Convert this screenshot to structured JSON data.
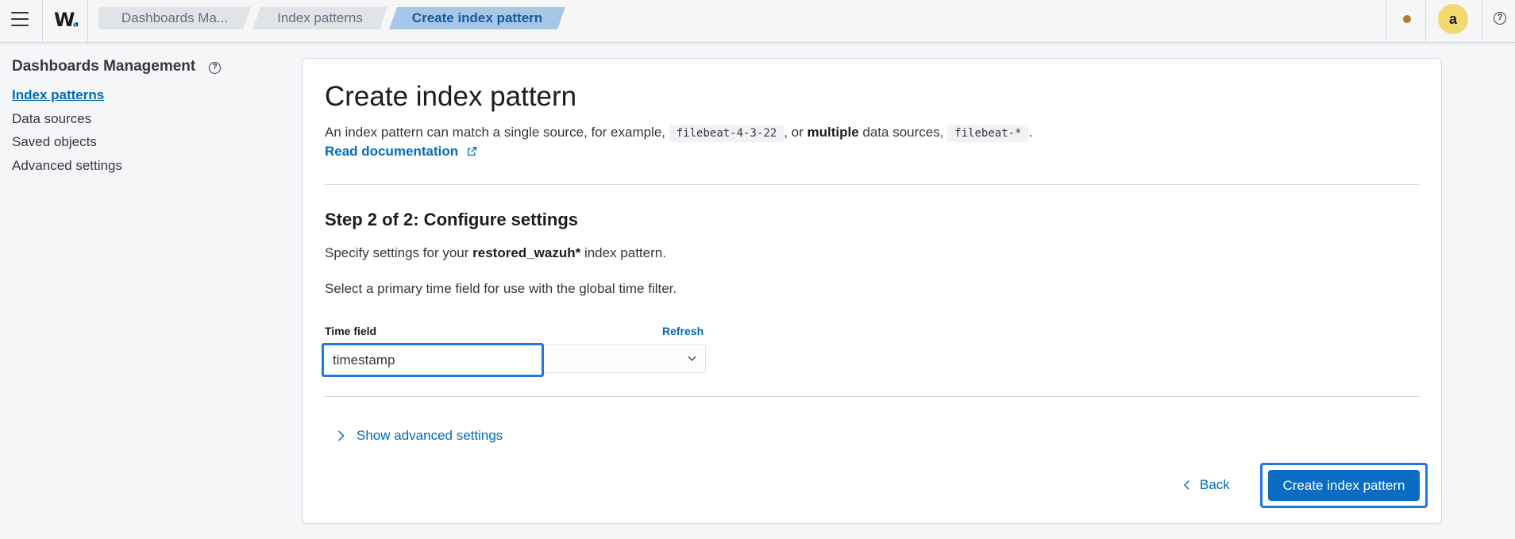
{
  "header": {
    "logo": "W.",
    "breadcrumbs": [
      "Dashboards Ma...",
      "Index patterns",
      "Create index pattern"
    ],
    "avatar_initial": "a",
    "help_glyph": "?",
    "colors": {
      "accent": "#006bb8",
      "status_dot": "#b07c2e",
      "avatar": "#f1d86f"
    }
  },
  "sidebar": {
    "title": "Dashboards Management",
    "help_glyph": "?",
    "items": [
      {
        "label": "Index patterns",
        "active": true
      },
      {
        "label": "Data sources",
        "active": false
      },
      {
        "label": "Saved objects",
        "active": false
      },
      {
        "label": "Advanced settings",
        "active": false
      }
    ]
  },
  "main": {
    "title": "Create index pattern",
    "description": {
      "part1": "An index pattern can match a single source, for example,",
      "code1": "filebeat-4-3-22",
      "part2": ", or",
      "bold": "multiple",
      "part3": "data sources,",
      "code2": "filebeat-*",
      "part4": "."
    },
    "doc_link": "Read documentation",
    "step_title": "Step 2 of 2: Configure settings",
    "specify": {
      "prefix": "Specify settings for your",
      "pattern": "restored_wazuh*",
      "suffix": "index pattern."
    },
    "select_text": "Select a primary time field for use with the global time filter.",
    "time_field": {
      "label": "Time field",
      "refresh_label": "Refresh",
      "value": "timestamp"
    },
    "advanced_toggle": "Show advanced settings",
    "back_label": "Back",
    "create_label": "Create index pattern"
  }
}
